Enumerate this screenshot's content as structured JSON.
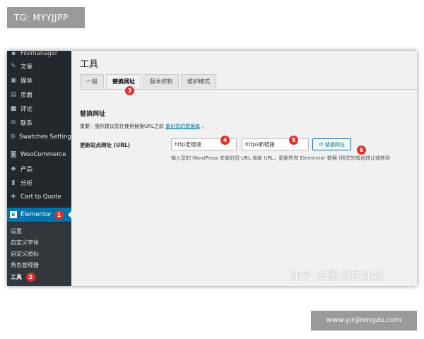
{
  "watermarks": {
    "tg": "TG: MYYJJPP",
    "site": "www.yinjirongzu.com",
    "zhihu": "知乎 @黑科技娃娃"
  },
  "sidebar": {
    "cut_item": "Filemanager",
    "items": [
      {
        "label": "文章",
        "icon": "pin-icon"
      },
      {
        "label": "媒体",
        "icon": "media-icon"
      },
      {
        "label": "页面",
        "icon": "page-icon"
      },
      {
        "label": "评论",
        "icon": "comment-icon"
      },
      {
        "label": "联系",
        "icon": "mail-icon"
      },
      {
        "label": "Swatches Settings",
        "icon": "gear-icon"
      },
      {
        "label": "WooCommerce",
        "icon": "woo-icon"
      },
      {
        "label": "产品",
        "icon": "box-icon"
      },
      {
        "label": "分析",
        "icon": "bar-chart-icon"
      },
      {
        "label": "Cart to Quote",
        "icon": "cart-icon"
      }
    ],
    "active_item": {
      "label": "Elementor",
      "icon": "elementor-icon",
      "badge": "1"
    },
    "submenu": [
      {
        "label": "设置"
      },
      {
        "label": "自定义字体"
      },
      {
        "label": "自定义图标"
      },
      {
        "label": "角色管理器"
      },
      {
        "label": "工具",
        "badge": "2"
      }
    ]
  },
  "main": {
    "title": "工具",
    "tabs": [
      {
        "label": "一般"
      },
      {
        "label": "替换网址",
        "badge": "3"
      },
      {
        "label": "版本控制"
      },
      {
        "label": "维护模式"
      }
    ],
    "section_title": "替换网址",
    "notice_prefix": "重要：强烈建议您在使用替换URL之前",
    "notice_link": "备份您的数据库",
    "notice_suffix": "。",
    "field_label": "更新站点网址 (URL)",
    "old_url_value": "http老链接",
    "old_badge": "4",
    "new_url_value": "https新链接",
    "new_badge": "5",
    "replace_button": "替换网址",
    "replace_badge": "6",
    "help_text": "输入您的 WordPress 安装的旧 URL 和新 URL，更新所有 Elementor 数据 (相关的域名转让或移到"
  }
}
